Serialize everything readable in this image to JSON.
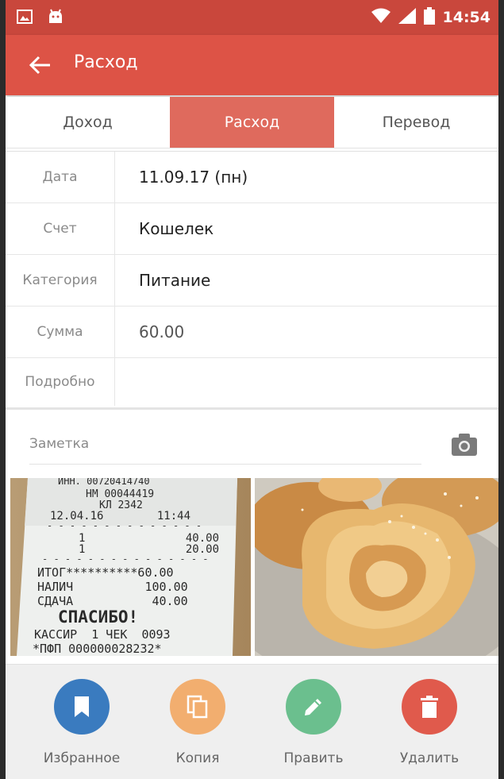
{
  "status_bar": {
    "time": "14:54"
  },
  "app_bar": {
    "title": "Расход"
  },
  "tabs": [
    {
      "label": "Доход",
      "active": false
    },
    {
      "label": "Расход",
      "active": true
    },
    {
      "label": "Перевод",
      "active": false
    }
  ],
  "form": {
    "date": {
      "label": "Дата",
      "value": "11.09.17 (пн)"
    },
    "account": {
      "label": "Счет",
      "value": "Кошелек"
    },
    "category": {
      "label": "Категория",
      "value": "Питание"
    },
    "amount": {
      "label": "Сумма",
      "value": "60.00"
    },
    "details": {
      "label": "Подробно",
      "value": ""
    }
  },
  "note": {
    "placeholder": "Заметка",
    "value": ""
  },
  "receipt": {
    "lines": [
      "ИНН. 00720414740",
      "НМ 00044419",
      "КЛ 2342",
      "12.04.16        11:44",
      "1               40.00",
      "1               20.00",
      "ИТОГ**********60.00",
      "НАЛИЧ          100.00",
      "СДАЧА           40.00",
      "СПАСИБО!",
      "КАССИР  1 ЧЕК  0093",
      "*ПФП 000000028232*"
    ]
  },
  "actions": [
    {
      "label": "Избранное",
      "color": "#3a7bbf",
      "icon": "bookmark-icon"
    },
    {
      "label": "Копия",
      "color": "#f2ae6f",
      "icon": "copy-icon"
    },
    {
      "label": "Править",
      "color": "#6bbf8e",
      "icon": "pencil-icon"
    },
    {
      "label": "Удалить",
      "color": "#e05a4c",
      "icon": "trash-icon"
    }
  ],
  "colors": {
    "status_bar": "#c9473c",
    "app_bar": "#dd5346",
    "active_tab": "#df6a5d"
  }
}
